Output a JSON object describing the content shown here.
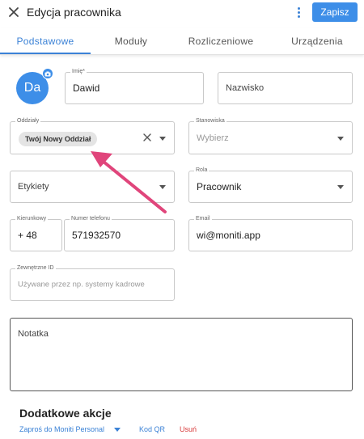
{
  "header": {
    "title": "Edycja pracownika",
    "save_label": "Zapisz",
    "close_icon": "close-icon",
    "menu_icon": "more-vert-icon"
  },
  "tabs": [
    {
      "label": "Podstawowe",
      "active": true
    },
    {
      "label": "Moduły",
      "active": false
    },
    {
      "label": "Rozliczeniowe",
      "active": false
    },
    {
      "label": "Urządzenia",
      "active": false
    }
  ],
  "avatar": {
    "initials": "Da",
    "camera_icon": "camera-icon"
  },
  "form": {
    "first_name": {
      "label": "Imię*",
      "value": "Dawid"
    },
    "last_name": {
      "placeholder": "Nazwisko"
    },
    "departments": {
      "label": "Oddziały",
      "chip": "Twój Nowy Oddział"
    },
    "positions": {
      "label": "Stanowiska",
      "placeholder": "Wybierz"
    },
    "tags": {
      "placeholder": "Etykiety"
    },
    "role": {
      "label": "Rola",
      "value": "Pracownik"
    },
    "dial_code": {
      "label": "Kierunkowy",
      "value": "+ 48"
    },
    "phone": {
      "label": "Numer telefonu",
      "value": "571932570"
    },
    "email": {
      "label": "Email",
      "value": "wi@moniti.app"
    },
    "external_id": {
      "label": "Zewnętrzne ID",
      "placeholder": "Używane przez np. systemy kadrowe"
    },
    "note": {
      "placeholder": "Notatka"
    }
  },
  "extra_actions": {
    "title": "Dodatkowe akcje",
    "invite": "Zaproś do Moniti Personal",
    "qr": "Kod QR",
    "delete": "Usuń"
  },
  "colors": {
    "accent": "#3d8ee8",
    "annotation_arrow": "#e0457b",
    "danger": "#d83b3b"
  }
}
